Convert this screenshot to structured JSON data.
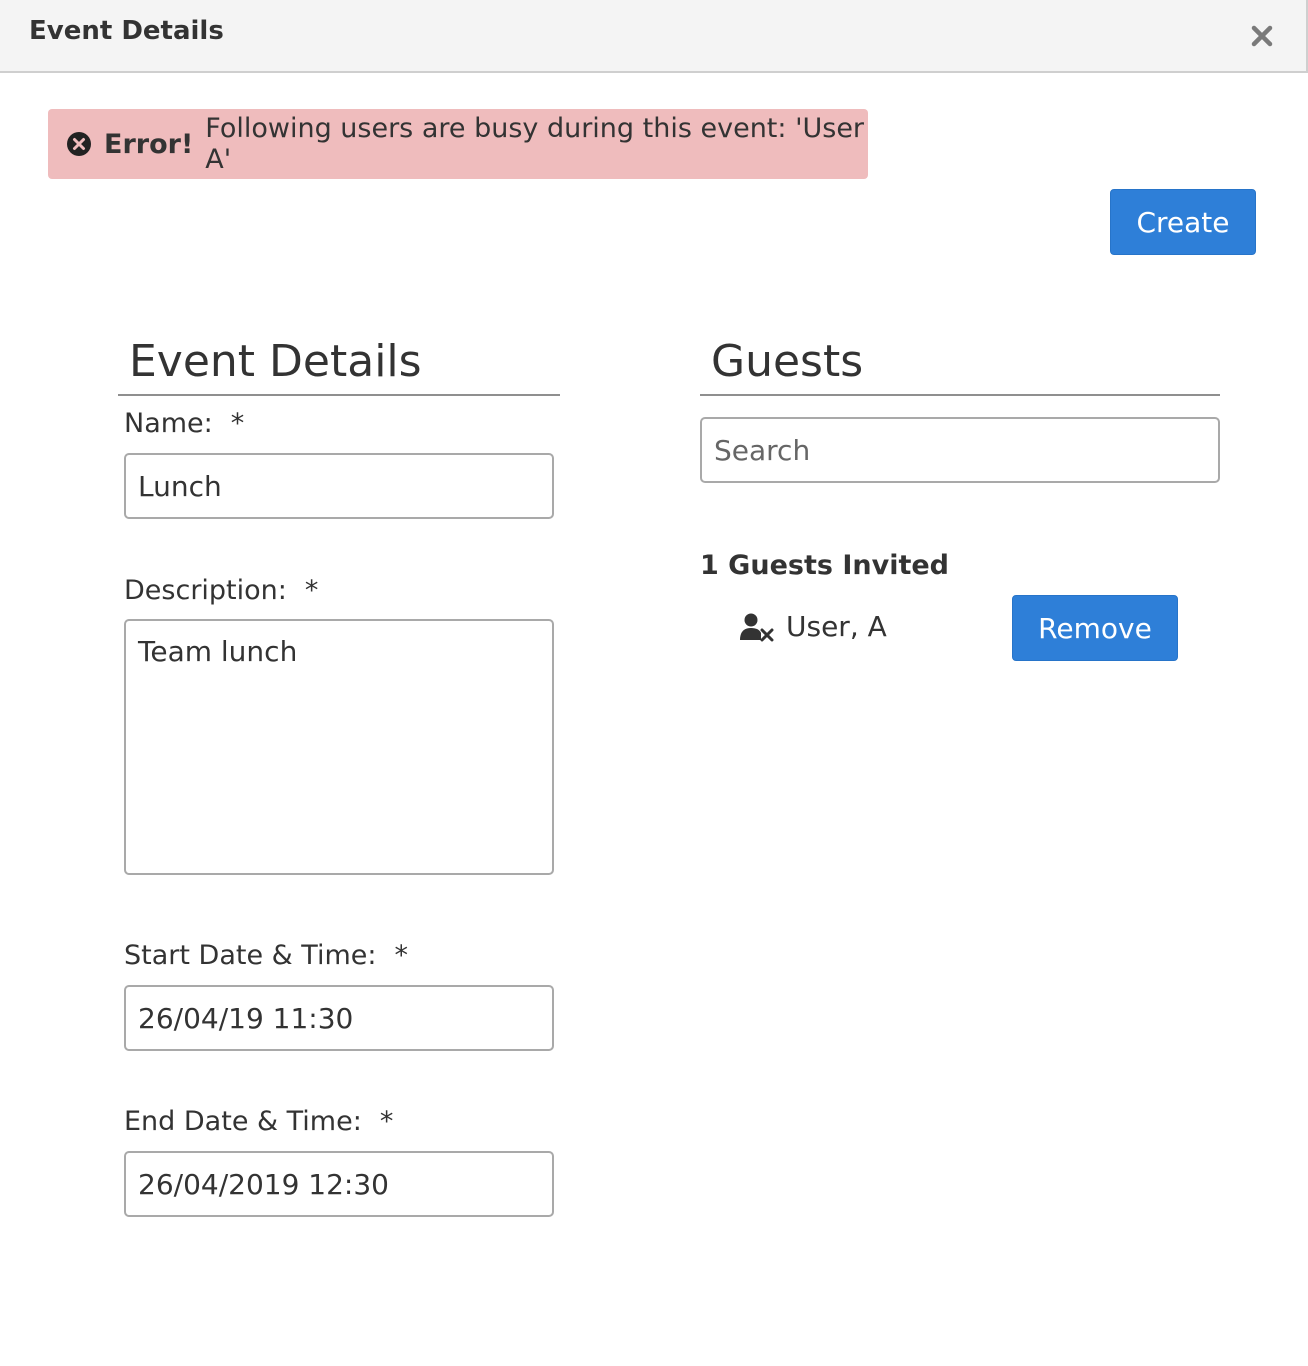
{
  "dialog": {
    "title": "Event Details",
    "close_icon": "close-icon"
  },
  "alert": {
    "icon": "error-circle-icon",
    "strong": "Error!",
    "message": "Following users are busy during this event: 'User A'",
    "background": "#efbcbd"
  },
  "actions": {
    "create_label": "Create"
  },
  "event_details": {
    "heading": "Event Details",
    "name_label": "Name:",
    "name_value": "Lunch",
    "description_label": "Description:",
    "description_value": "Team lunch",
    "start_label": "Start Date & Time:",
    "start_value": "26/04/19 11:30",
    "end_label": "End Date & Time:",
    "end_value": "26/04/2019 12:30",
    "required_marker": "*"
  },
  "guests": {
    "heading": "Guests",
    "search_placeholder": "Search",
    "count_label": "1 Guests Invited",
    "items": [
      {
        "name": "User, A",
        "icon": "user-remove-icon",
        "button_label": "Remove"
      }
    ]
  },
  "colors": {
    "primary": "#2e7fd8",
    "titlebar": "#f4f4f4",
    "text": "#333333"
  }
}
